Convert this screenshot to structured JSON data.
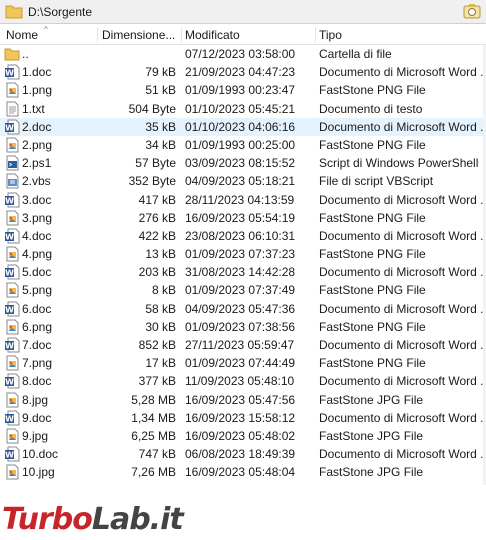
{
  "window": {
    "path": "D:\\Sorgente"
  },
  "columns": {
    "name": "Nome",
    "size": "Dimensione...",
    "modified": "Modificato",
    "type": "Tipo"
  },
  "files": [
    {
      "name": "..",
      "size": "",
      "modified": "07/12/2023 03:58:00",
      "type": "Cartella di file",
      "icon": "folder-icon"
    },
    {
      "name": "1.doc",
      "size": "79 kB",
      "modified": "21/09/2023 04:47:23",
      "type": "Documento di Microsoft Word ...",
      "icon": "word-doc-icon"
    },
    {
      "name": "1.png",
      "size": "51 kB",
      "modified": "01/09/1993 00:23:47",
      "type": "FastStone PNG File",
      "icon": "image-icon"
    },
    {
      "name": "1.txt",
      "size": "504 Byte",
      "modified": "01/10/2023 05:45:21",
      "type": "Documento di testo",
      "icon": "text-file-icon"
    },
    {
      "name": "2.doc",
      "size": "35 kB",
      "modified": "01/10/2023 04:06:16",
      "type": "Documento di Microsoft Word ...",
      "icon": "word-doc-icon",
      "selected": true
    },
    {
      "name": "2.png",
      "size": "34 kB",
      "modified": "01/09/1993 00:25:00",
      "type": "FastStone PNG File",
      "icon": "image-icon"
    },
    {
      "name": "2.ps1",
      "size": "57 Byte",
      "modified": "03/09/2023 08:15:52",
      "type": "Script di Windows PowerShell",
      "icon": "powershell-icon"
    },
    {
      "name": "2.vbs",
      "size": "352 Byte",
      "modified": "04/09/2023 05:18:21",
      "type": "File di script VBScript",
      "icon": "vbscript-icon"
    },
    {
      "name": "3.doc",
      "size": "417 kB",
      "modified": "28/11/2023 04:13:59",
      "type": "Documento di Microsoft Word ...",
      "icon": "word-doc-icon"
    },
    {
      "name": "3.png",
      "size": "276 kB",
      "modified": "16/09/2023 05:54:19",
      "type": "FastStone PNG File",
      "icon": "image-icon"
    },
    {
      "name": "4.doc",
      "size": "422 kB",
      "modified": "23/08/2023 06:10:31",
      "type": "Documento di Microsoft Word ...",
      "icon": "word-doc-icon"
    },
    {
      "name": "4.png",
      "size": "13 kB",
      "modified": "01/09/2023 07:37:23",
      "type": "FastStone PNG File",
      "icon": "image-icon"
    },
    {
      "name": "5.doc",
      "size": "203 kB",
      "modified": "31/08/2023 14:42:28",
      "type": "Documento di Microsoft Word ...",
      "icon": "word-doc-icon"
    },
    {
      "name": "5.png",
      "size": "8 kB",
      "modified": "01/09/2023 07:37:49",
      "type": "FastStone PNG File",
      "icon": "image-icon"
    },
    {
      "name": "6.doc",
      "size": "58 kB",
      "modified": "04/09/2023 05:47:36",
      "type": "Documento di Microsoft Word ...",
      "icon": "word-doc-icon"
    },
    {
      "name": "6.png",
      "size": "30 kB",
      "modified": "01/09/2023 07:38:56",
      "type": "FastStone PNG File",
      "icon": "image-icon"
    },
    {
      "name": "7.doc",
      "size": "852 kB",
      "modified": "27/11/2023 05:59:47",
      "type": "Documento di Microsoft Word ...",
      "icon": "word-doc-icon"
    },
    {
      "name": "7.png",
      "size": "17 kB",
      "modified": "01/09/2023 07:44:49",
      "type": "FastStone PNG File",
      "icon": "image-icon"
    },
    {
      "name": "8.doc",
      "size": "377 kB",
      "modified": "11/09/2023 05:48:10",
      "type": "Documento di Microsoft Word ...",
      "icon": "word-doc-icon"
    },
    {
      "name": "8.jpg",
      "size": "5,28 MB",
      "modified": "16/09/2023 05:47:56",
      "type": "FastStone JPG File",
      "icon": "image-icon"
    },
    {
      "name": "9.doc",
      "size": "1,34 MB",
      "modified": "16/09/2023 15:58:12",
      "type": "Documento di Microsoft Word ...",
      "icon": "word-doc-icon"
    },
    {
      "name": "9.jpg",
      "size": "6,25 MB",
      "modified": "16/09/2023 05:48:02",
      "type": "FastStone JPG File",
      "icon": "image-icon"
    },
    {
      "name": "10.doc",
      "size": "747 kB",
      "modified": "06/08/2023 18:49:39",
      "type": "Documento di Microsoft Word ...",
      "icon": "word-doc-icon"
    },
    {
      "name": "10.jpg",
      "size": "7,26 MB",
      "modified": "16/09/2023 05:48:04",
      "type": "FastStone JPG File",
      "icon": "image-icon"
    }
  ],
  "watermark": {
    "part1": "Turbo",
    "part2": "Lab.it"
  },
  "colors": {
    "selection": "#e5f3ff",
    "folder": "#f2c55c",
    "word": "#2b579a",
    "watermark_red": "#c8252b"
  }
}
